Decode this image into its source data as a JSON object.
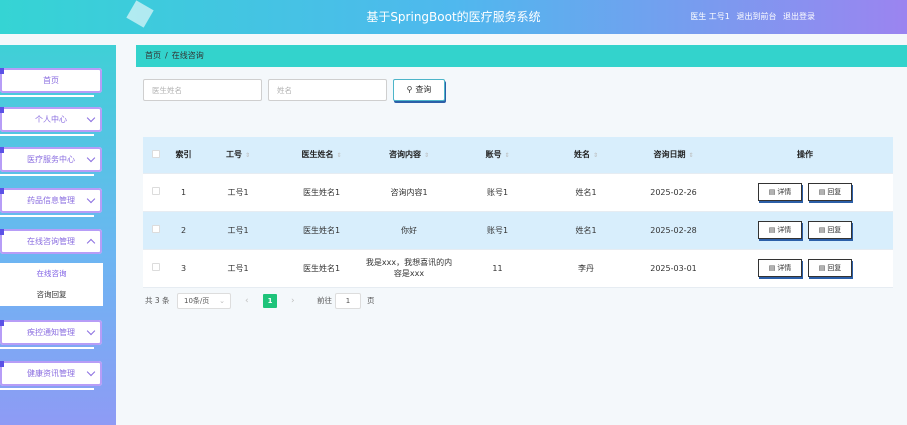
{
  "header": {
    "title": "基于SpringBoot的医疗服务系统",
    "user_label": "医生 工号1",
    "exit_console": "退出到前台",
    "logout": "退出登录"
  },
  "sidebar": {
    "items": [
      {
        "label": "首页",
        "has_arrow": false
      },
      {
        "label": "个人中心",
        "has_arrow": true
      },
      {
        "label": "医疗服务中心",
        "has_arrow": true
      },
      {
        "label": "药品信息管理",
        "has_arrow": true
      },
      {
        "label": "在线咨询管理",
        "has_arrow": true,
        "expanded": true
      },
      {
        "label": "疾控通知管理",
        "has_arrow": true
      },
      {
        "label": "健康资讯管理",
        "has_arrow": true
      }
    ],
    "submenu": [
      {
        "label": "在线咨询",
        "active": true
      },
      {
        "label": "咨询回复",
        "active": false
      }
    ]
  },
  "breadcrumb": {
    "home": "首页",
    "separator": "/",
    "current": "在线咨询"
  },
  "search": {
    "doctor_name_placeholder": "医生姓名",
    "name_placeholder": "姓名",
    "button_label": "查询"
  },
  "table": {
    "columns": [
      "索引",
      "工号",
      "医生姓名",
      "咨询内容",
      "账号",
      "姓名",
      "咨询日期",
      "操作"
    ],
    "rows": [
      {
        "index": "1",
        "job_no": "工号1",
        "doctor": "医生姓名1",
        "content": "咨询内容1",
        "account": "账号1",
        "name": "姓名1",
        "date": "2025-02-26"
      },
      {
        "index": "2",
        "job_no": "工号1",
        "doctor": "医生姓名1",
        "content": "你好",
        "account": "账号1",
        "name": "姓名1",
        "date": "2025-02-28"
      },
      {
        "index": "3",
        "job_no": "工号1",
        "doctor": "医生姓名1",
        "content": "我是xxx，我想喜讯的内容是xxx",
        "account": "11",
        "name": "李丹",
        "date": "2025-03-01"
      }
    ],
    "actions": {
      "detail": "详情",
      "reply": "回复"
    }
  },
  "pagination": {
    "total": "共 3 条",
    "page_size": "10条/页",
    "current_page": "1",
    "goto_label": "前往",
    "goto_value": "1",
    "page_unit": "页"
  },
  "colors": {
    "accent": "#33d3cc",
    "purple": "#8a6de0",
    "page_active": "#1ec37a"
  }
}
